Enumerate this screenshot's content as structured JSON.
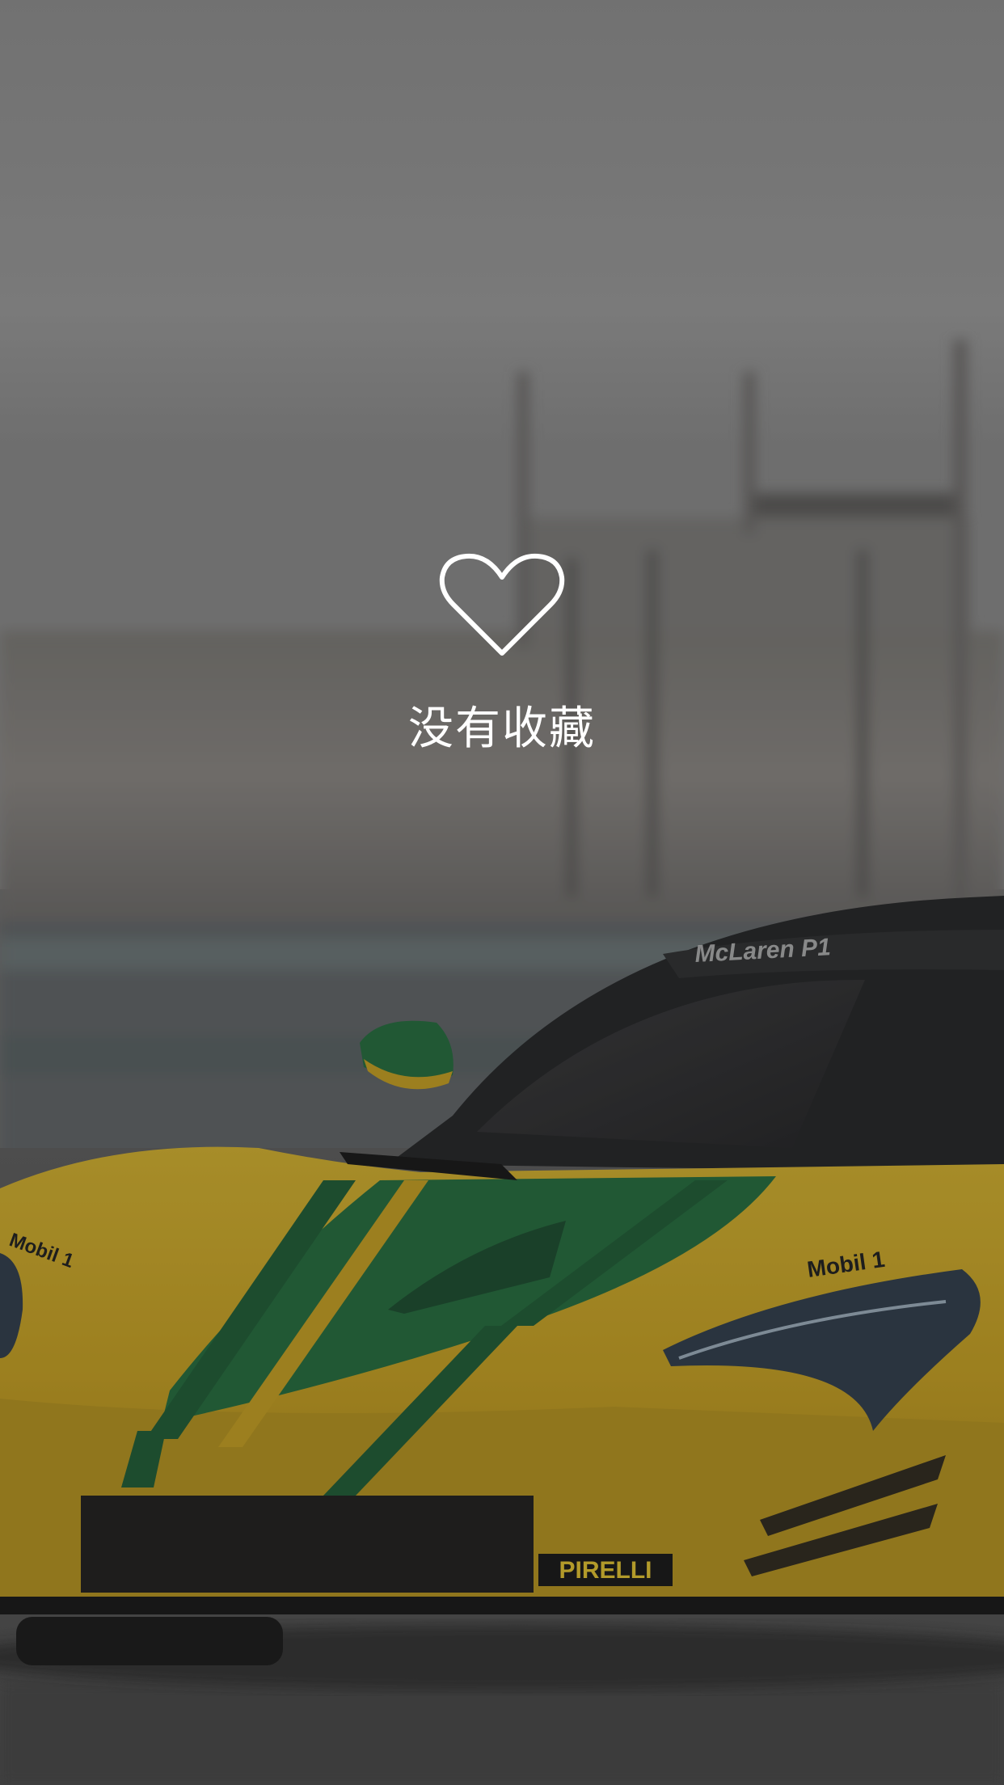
{
  "empty_state": {
    "icon": "heart-outline-icon",
    "message": "没有收藏",
    "icon_color": "#ffffff"
  },
  "background": {
    "subject": "yellow and green sports car",
    "badges": [
      "Mobil 1",
      "PIRELLI"
    ]
  }
}
